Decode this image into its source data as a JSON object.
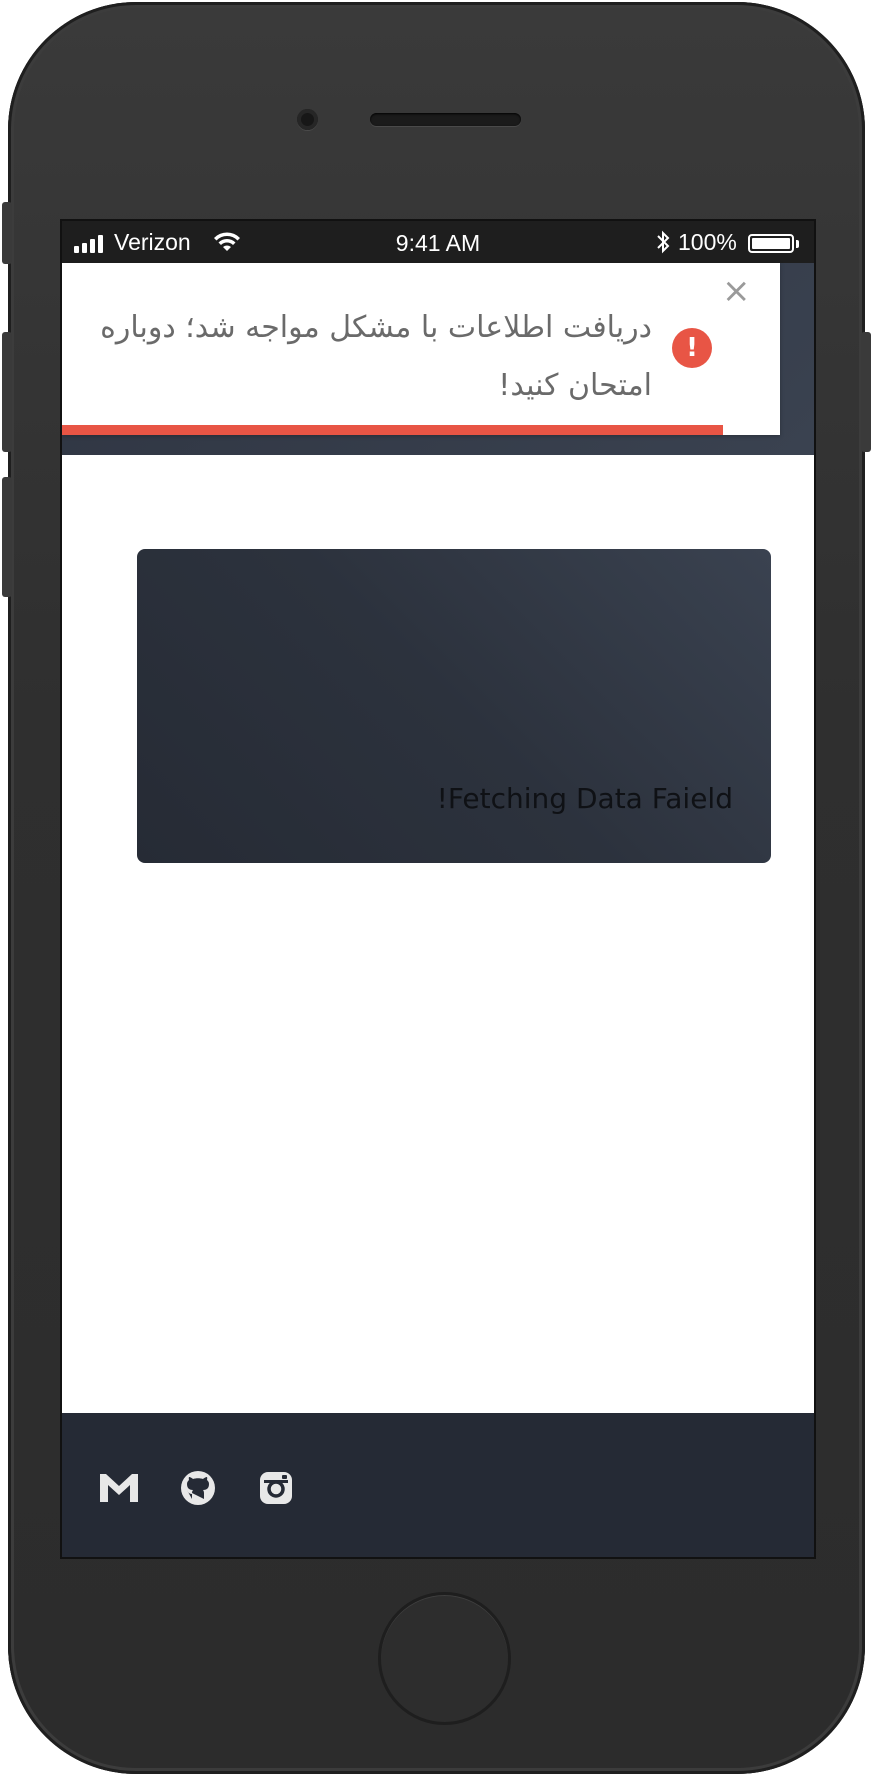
{
  "status_bar": {
    "carrier": "Verizon",
    "time": "9:41 AM",
    "battery_percent": "100%",
    "battery_level": 1.0,
    "icons": [
      "signal-icon",
      "wifi-icon",
      "bluetooth-icon",
      "battery-icon"
    ]
  },
  "toast": {
    "message": "دریافت اطلاعات با مشکل مواجه شد؛ دوباره امتحان کنید!",
    "close_symbol": "×",
    "icon_symbol": "!",
    "icon": "error-icon",
    "progress_fraction": 0.92,
    "accent_color": "#e85545"
  },
  "error_card": {
    "text": "Fetching Data Faield!"
  },
  "footer": {
    "social_links": [
      {
        "name": "gmail",
        "icon": "gmail-icon"
      },
      {
        "name": "github",
        "icon": "github-icon"
      },
      {
        "name": "instagram",
        "icon": "instagram-icon"
      }
    ]
  },
  "colors": {
    "header_band": "#2f3542",
    "card": "#2c323d",
    "footer": "#252a35",
    "error": "#e85545"
  }
}
